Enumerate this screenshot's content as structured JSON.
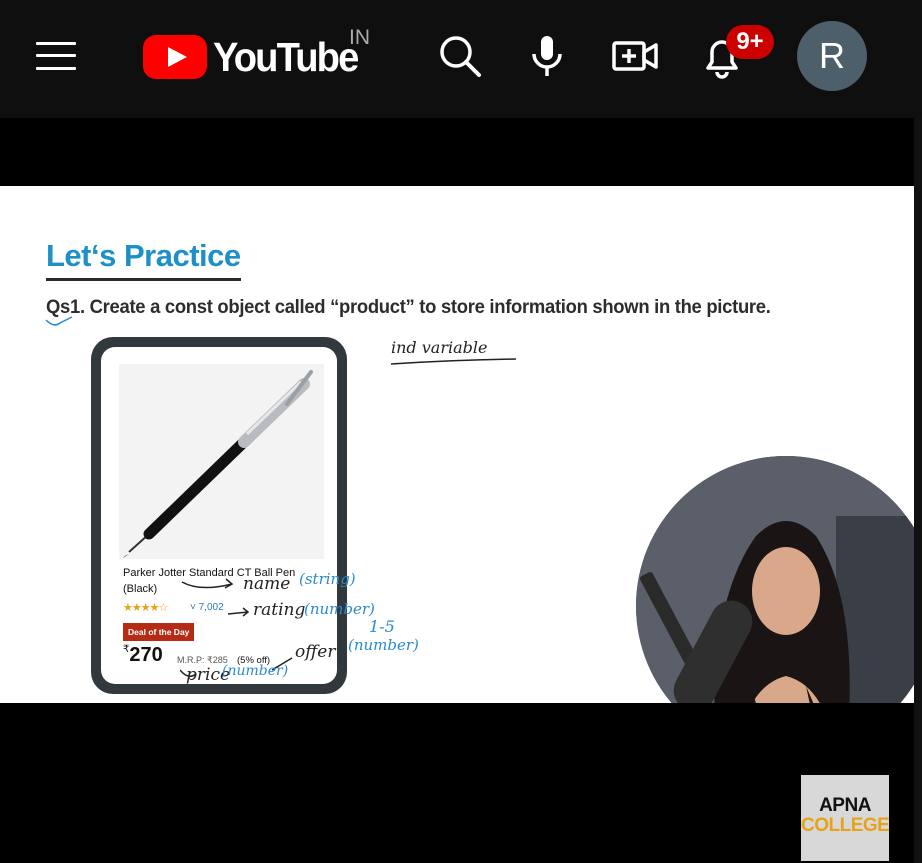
{
  "header": {
    "logo_text": "YouTube",
    "region_code": "IN",
    "notification_count": "9+",
    "avatar_letter": "R",
    "brand_red": "#ff0000",
    "icons": [
      "menu-icon",
      "search-icon",
      "microphone-icon",
      "create-video-icon",
      "notifications-bell-icon"
    ]
  },
  "slide": {
    "title": "Let‘s Practice",
    "question": "Qs1. Create a const object called “product” to store information shown in the picture.",
    "note_top": "ind variable",
    "product": {
      "name": "Parker Jotter Standard CT Ball Pen (Black)",
      "stars": "★★★★☆",
      "rating_count": "˅ 7,002",
      "deal_badge": "Deal of the Day",
      "price_symbol": "₹",
      "price": "270",
      "mrp": "M.R.P: ₹285",
      "discount": "(5% off)"
    },
    "annotations": {
      "name_label": "name",
      "name_type": "(string)",
      "rating_label": "rating",
      "rating_type": "(number)",
      "range_label": "1-5",
      "range_type": "(number)",
      "offer_label": "offer",
      "price_label": "price",
      "price_type": "(number)"
    },
    "accent_blue": "#1e90c8"
  },
  "watermark": {
    "line1": "APNA",
    "line2": "COLLEGE"
  }
}
